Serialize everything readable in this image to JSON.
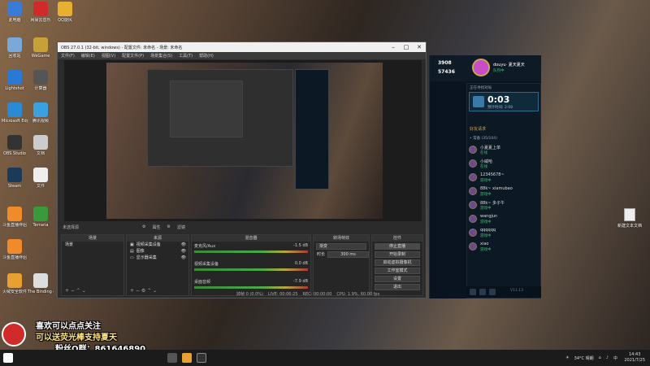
{
  "desktop": {
    "icons_left": [
      {
        "label": "此电脑",
        "icon": "computer-icon",
        "color": "#3a7bd5"
      },
      {
        "label": "网易云音乐",
        "icon": "music-icon",
        "color": "#d02a2a"
      },
      {
        "label": "QQ旋风",
        "icon": "qq-icon",
        "color": "#e8b030"
      },
      {
        "label": "回收站",
        "icon": "recycle-bin-icon",
        "color": "#7aa8d8"
      },
      {
        "label": "WeGame",
        "icon": "wegame-icon",
        "color": "#c8a03a"
      },
      {
        "label": "Lightshot",
        "icon": "lightshot-icon",
        "color": "#2a7ad5"
      },
      {
        "label": "计算器",
        "icon": "app-icon",
        "color": "#555"
      },
      {
        "label": "Microsoft Edge",
        "icon": "edge-icon",
        "color": "#2a8ad5"
      },
      {
        "label": "腾讯视频",
        "icon": "video-icon",
        "color": "#3aa0e0"
      },
      {
        "label": "OBS Studio",
        "icon": "obs-icon",
        "color": "#333"
      },
      {
        "label": "文档",
        "icon": "document-icon",
        "color": "#ccc"
      },
      {
        "label": "Steam",
        "icon": "steam-icon",
        "color": "#1a3a5a"
      },
      {
        "label": "文件",
        "icon": "file-icon",
        "color": "#eee"
      },
      {
        "label": "斗鱼直播伴侣",
        "icon": "douyu-icon",
        "color": "#f08a2a"
      },
      {
        "label": "Terraria",
        "icon": "terraria-icon",
        "color": "#3a9a3a"
      },
      {
        "label": "斗鱼直播伴侣",
        "icon": "douyu-icon",
        "color": "#f08a2a"
      },
      {
        "label": "火绒安全软件",
        "icon": "huorong-icon",
        "color": "#e8a030"
      },
      {
        "label": "The Binding of Isaac R...",
        "icon": "isaac-icon",
        "color": "#ddd"
      }
    ],
    "right_file": {
      "label": "新建文本文档",
      "icon": "text-file-icon"
    }
  },
  "obs": {
    "title": "OBS 27.0.1 (32-bit, windows) - 配置文件: 未命名 - 场景: 未命名",
    "menu": [
      "文件(F)",
      "编辑(E)",
      "视图(V)",
      "配置文件(P)",
      "场景集合(S)",
      "工具(T)",
      "帮助(H)"
    ],
    "preview_toolbar": [
      "属性",
      "滤镜"
    ],
    "bottom_header": "未选择源",
    "docks": {
      "scenes": {
        "title": "场景",
        "items": [
          "场景"
        ]
      },
      "sources": {
        "title": "来源",
        "items": [
          "视频采集设备",
          "图像",
          "显示器采集"
        ]
      },
      "mixer": {
        "title": "混音器",
        "channels": [
          {
            "name": "麦克风/Aux",
            "db": "-1.5 dB"
          },
          {
            "name": "视频采集设备",
            "db": "0.0 dB"
          },
          {
            "name": "桌面音频",
            "db": "-7.9 dB"
          }
        ]
      },
      "transitions": {
        "title": "转场特效",
        "type": "渐变",
        "duration_label": "时长",
        "duration": "300 ms"
      },
      "controls": {
        "title": "控件",
        "buttons": [
          "停止直播",
          "开始录制",
          "启动虚拟摄像机",
          "工作室模式",
          "设置",
          "退出"
        ]
      }
    },
    "status": {
      "live": "LIVE: 00:06:25",
      "rec": "REC: 00:00:00",
      "cpu": "CPU: 1.9%, 60.00 fps",
      "drop": "掉帧 0 (0.0%)"
    }
  },
  "lol": {
    "be": "3908",
    "rp": "57436",
    "player_name": "douyu· 夏天夏天",
    "player_status": "队列中",
    "queue_label": "正在寻找对局",
    "timer": "0:03",
    "queue_sub": "预计时间: 2:08",
    "section_friends": "好友请求",
    "online_header": "• 常备 (35/104)",
    "friends": [
      {
        "name": "小夏夏上单",
        "status": "在线"
      },
      {
        "name": "小威哈",
        "status": "在线"
      },
      {
        "name": "12345678~",
        "status": "游戏中"
      },
      {
        "name": "88k~ xiamubao",
        "status": "游戏中"
      },
      {
        "name": "88k~ 多子午",
        "status": "游戏中"
      },
      {
        "name": "wangjun",
        "status": "游戏中"
      },
      {
        "name": "qqqqqq",
        "status": "游戏中"
      },
      {
        "name": "xiao",
        "status": "游戏中"
      }
    ],
    "version": "V11.13"
  },
  "overlay": {
    "line1": "喜欢可以点点关注",
    "line2": "可以送荧光棒支持夏天",
    "line3": "粉丝Q群：861646890"
  },
  "taskbar": {
    "weather": "34°C 晴朗",
    "time": "14:43",
    "date": "2021/7/25"
  }
}
